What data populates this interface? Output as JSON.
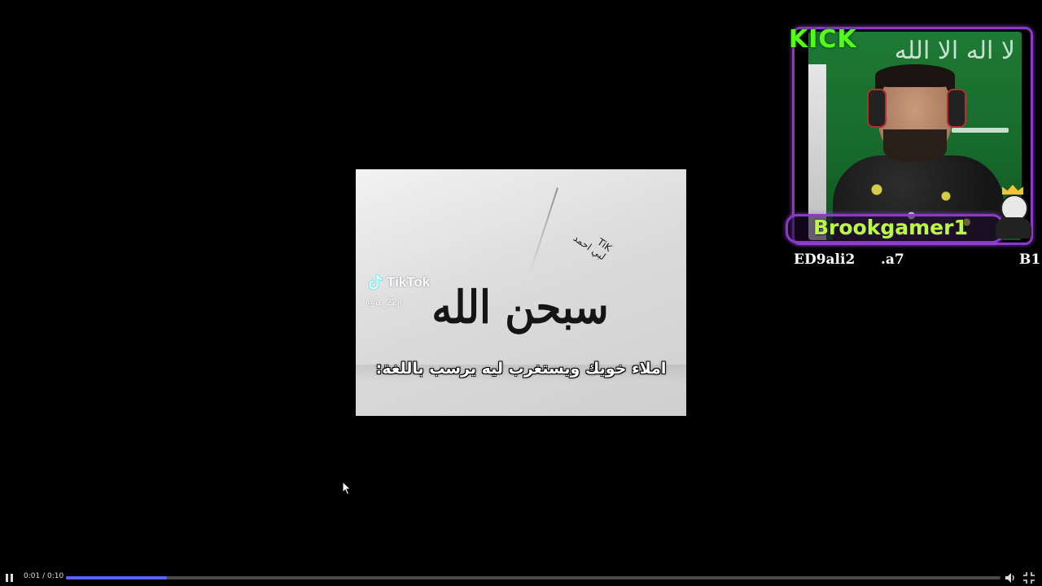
{
  "video": {
    "tiktok_brand": "TikTok",
    "tiktok_handle": "@a_22jl",
    "calligraphy_text": "سبحن الله",
    "scribble_text": "TiK\nلبي احمد",
    "subtitle": "املاء خويك ويستغرب ليه يرسب باللغة:"
  },
  "stream_overlay": {
    "platform_logo": "KICK",
    "streamer_name": "Brookgamer1",
    "flag_text": "لا اله الا الله",
    "ticker_items": [
      "ED9ali2",
      ".a7",
      "B1"
    ],
    "accent_color": "#53fc18",
    "frame_color": "#8a39c9"
  },
  "player": {
    "current_time": "0:01",
    "duration": "0:10",
    "time_display": "0:01 / 0:10",
    "progress": 0.108,
    "progress_color": "#5b64ff",
    "play_state_icon": "pause-icon",
    "volume_icon": "volume-icon",
    "fullscreen_icon": "exit-fullscreen-icon"
  }
}
